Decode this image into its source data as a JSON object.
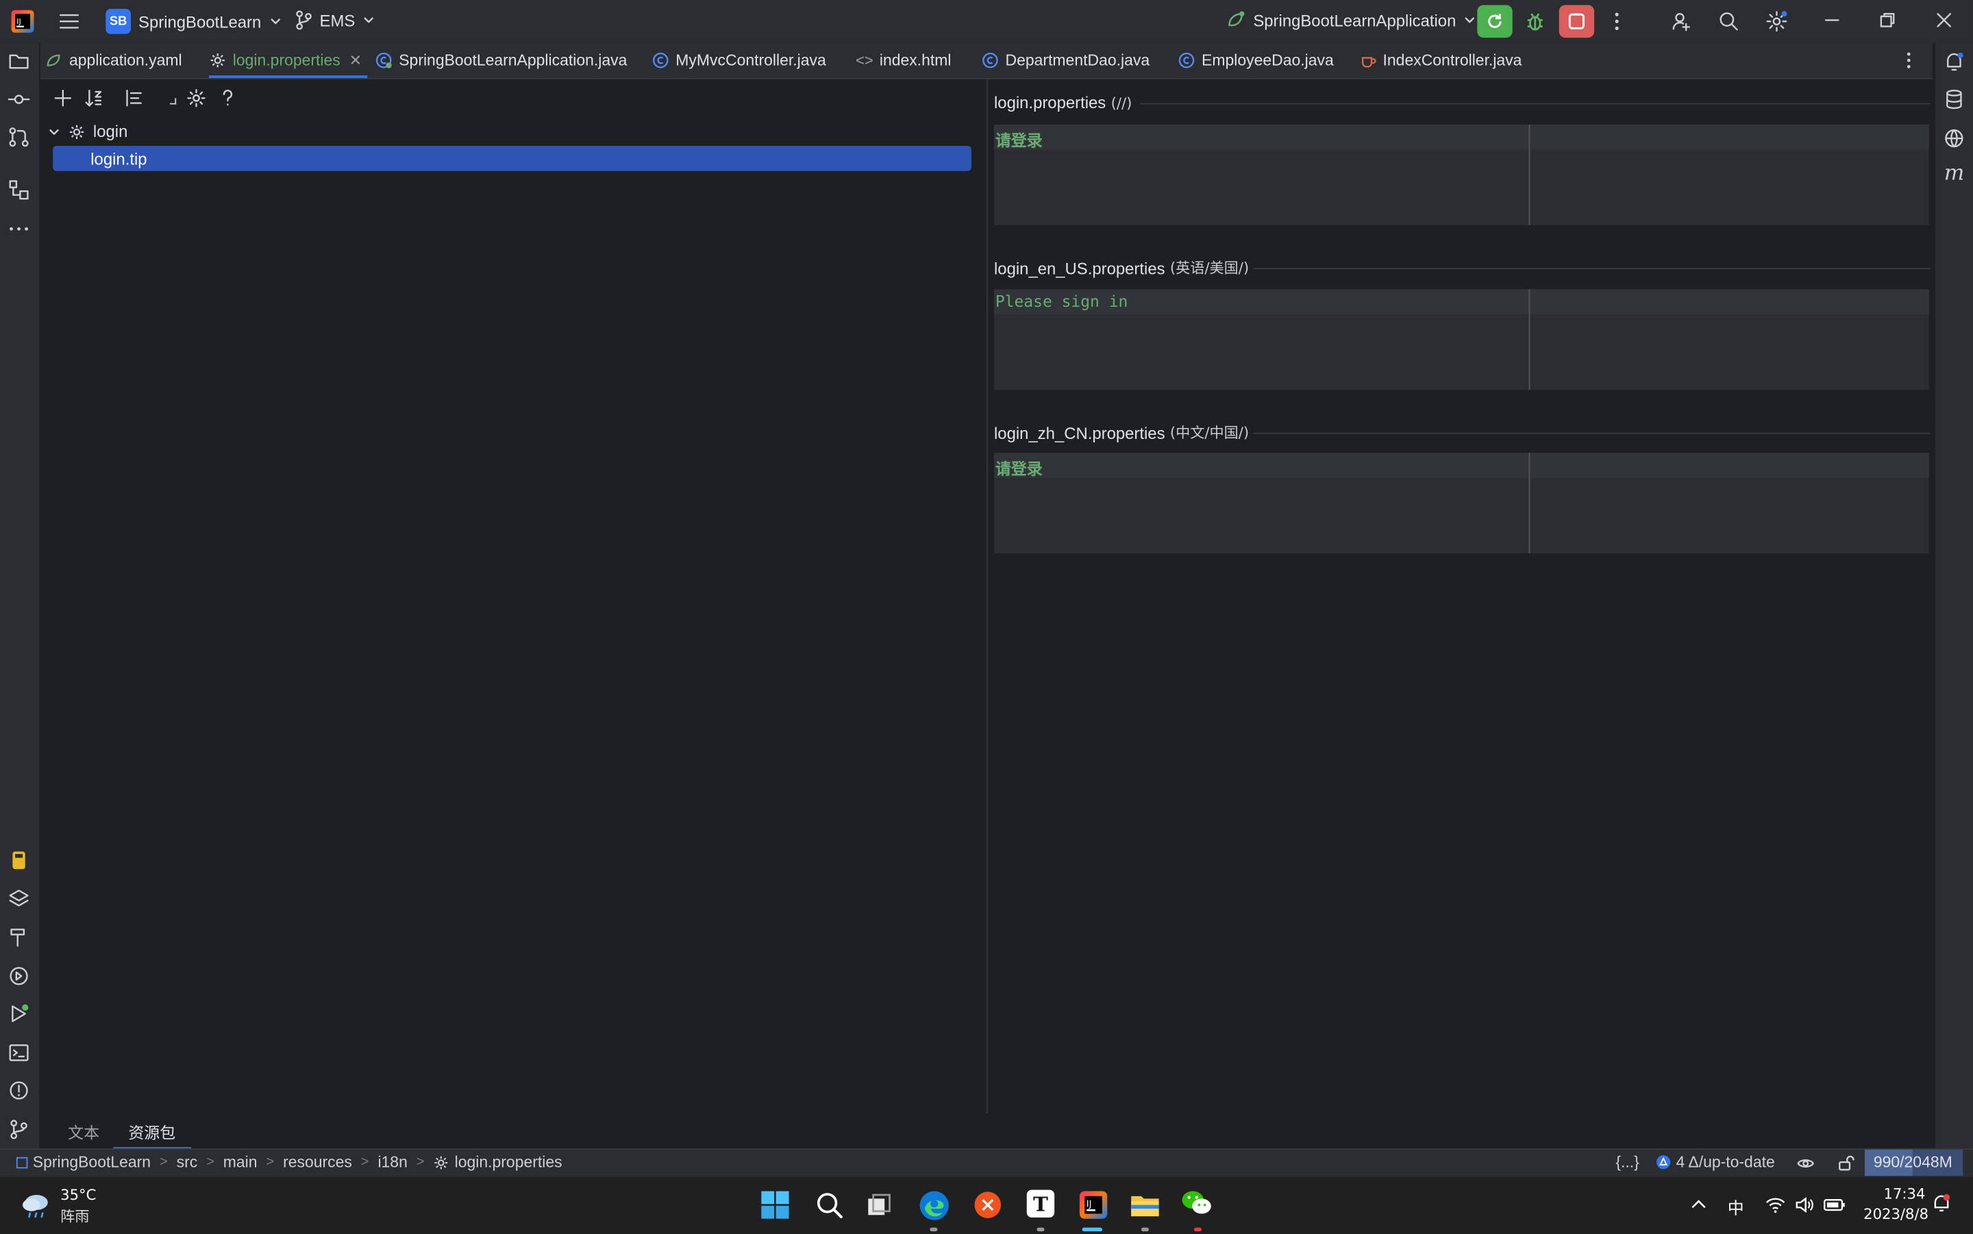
{
  "titlebar": {
    "project_badge": "SB",
    "project_name": "SpringBootLearn",
    "branch": "EMS",
    "run_config": "SpringBootLearnApplication"
  },
  "tabs": [
    {
      "label": "application.yaml",
      "active": false
    },
    {
      "label": "login.properties",
      "active": true
    },
    {
      "label": "SpringBootLearnApplication.java",
      "active": false
    },
    {
      "label": "MyMvcController.java",
      "active": false
    },
    {
      "label": "index.html",
      "active": false
    },
    {
      "label": "DepartmentDao.java",
      "active": false
    },
    {
      "label": "EmployeeDao.java",
      "active": false
    },
    {
      "label": "IndexController.java",
      "active": false
    }
  ],
  "tree": {
    "group": "login",
    "item": "login.tip"
  },
  "sections": [
    {
      "file": "login.properties",
      "locale": "(//)",
      "value": "请登录"
    },
    {
      "file": "login_en_US.properties",
      "locale": "(英语/美国/)",
      "value": "Please sign in"
    },
    {
      "file": "login_zh_CN.properties",
      "locale": "(中文/中国/)",
      "value": "请登录"
    }
  ],
  "bottom_tabs": [
    "文本",
    "资源包"
  ],
  "breadcrumb": [
    "SpringBootLearn",
    "src",
    "main",
    "resources",
    "i18n",
    "login.properties"
  ],
  "status": {
    "braces": "{...}",
    "vcs": "4 Δ/up-to-date",
    "memory": "990/2048M"
  },
  "taskbar": {
    "temperature": "35°C",
    "weather": "阵雨",
    "ime": "中",
    "time": "17:34",
    "date": "2023/8/8"
  },
  "colors": {
    "accent": "#3574f0",
    "string_green": "#6aab73",
    "run_green": "#4caf50",
    "stop_red": "#db5c5c"
  }
}
